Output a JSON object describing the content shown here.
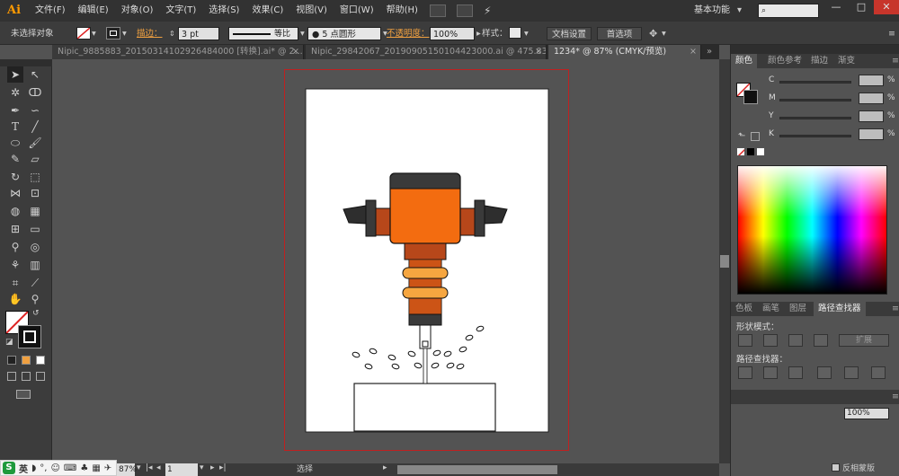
{
  "menubar": {
    "logo": "Ai",
    "items": [
      "文件(F)",
      "编辑(E)",
      "对象(O)",
      "文字(T)",
      "选择(S)",
      "效果(C)",
      "视图(V)",
      "窗口(W)",
      "帮助(H)"
    ],
    "workspace": "基本功能",
    "win_min": "—",
    "win_max": "□",
    "win_close": "✕"
  },
  "controlbar": {
    "selection": "未选择对象",
    "stroke_label": "描边：",
    "stroke_value": "3 pt",
    "line_style": "等比",
    "brush": "5 点圆形",
    "opacity_label": "不透明度：",
    "opacity_value": "100%",
    "style_label": "样式：",
    "doc_setup": "文档设置",
    "preferences": "首选项"
  },
  "tabs": [
    {
      "label": "Nipic_9885883_20150314102926484000 [转换].ai* @ 2...",
      "close": "×",
      "active": false
    },
    {
      "label": "Nipic_29842067_20190905150104423000.ai @ 475.83%...",
      "close": "×",
      "active": false
    },
    {
      "label": "1234* @ 87% (CMYK/预览)",
      "close": "×",
      "active": true
    }
  ],
  "panel": {
    "top_tabs": [
      "颜色",
      "颜色参考",
      "描边",
      "渐变"
    ],
    "channels": [
      "C",
      "M",
      "Y",
      "K"
    ],
    "pct": "%",
    "mid_tabs": [
      "色板",
      "画笔",
      "图层",
      "路径查找器"
    ],
    "shape_modes": "形状模式：",
    "expand": "扩展",
    "pathfinders": "路径查找器："
  },
  "panel_extra": {
    "pct_field": "100%",
    "layer_label": "反相蒙版"
  },
  "statusbar": {
    "zoom": "87%",
    "page": "1",
    "tool": "选择"
  },
  "ime": {
    "logo": "S",
    "lang": "英"
  },
  "colors": {
    "orange": "#f36c10",
    "dark_orange": "#b7471a",
    "light_orange": "#f6a640",
    "gray_dark": "#3a3a3a",
    "artboard_border": "#c02020"
  }
}
